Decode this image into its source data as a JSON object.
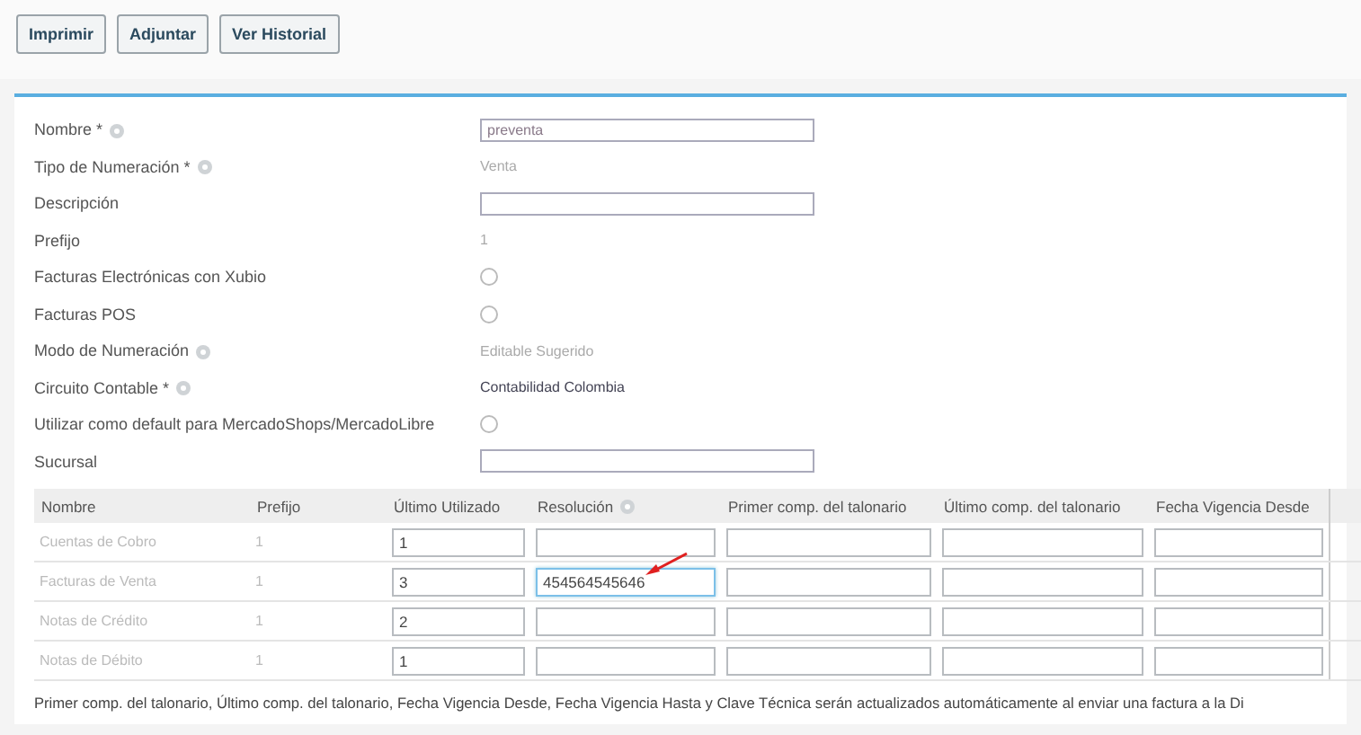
{
  "toolbar": {
    "buttons": [
      "Imprimir",
      "Adjuntar",
      "Ver Historial"
    ]
  },
  "form": {
    "fields": [
      {
        "label": "Nombre *",
        "help": true,
        "kind": "input",
        "value": "preventa"
      },
      {
        "label": "Tipo de Numeración *",
        "help": true,
        "kind": "text",
        "value": "Venta"
      },
      {
        "label": "Descripción",
        "help": false,
        "kind": "input"
      },
      {
        "label": "Prefijo",
        "help": false,
        "kind": "text",
        "value": "1"
      },
      {
        "label": "Facturas Electrónicas con Xubio",
        "help": false,
        "kind": "checkbox",
        "checked": false
      },
      {
        "label": "Facturas POS",
        "help": false,
        "kind": "checkbox",
        "checked": false
      },
      {
        "label": "Modo de Numeración",
        "help": true,
        "kind": "text",
        "value": "Editable Sugerido"
      },
      {
        "label": "Circuito Contable *",
        "help": true,
        "kind": "strong",
        "value": "Contabilidad Colombia"
      },
      {
        "label": "Utilizar como default para MercadoShops/MercadoLibre",
        "help": false,
        "kind": "checkbox",
        "checked": false
      },
      {
        "label": "Sucursal",
        "help": false,
        "kind": "input"
      }
    ]
  },
  "table": {
    "columns": [
      {
        "label": "Nombre",
        "help": false
      },
      {
        "label": "Prefijo",
        "help": false
      },
      {
        "label": "Último Utilizado",
        "help": false
      },
      {
        "label": "Resolución",
        "help": true
      },
      {
        "label": "Primer comp. del talonario",
        "help": false
      },
      {
        "label": "Último comp. del talonario",
        "help": false
      },
      {
        "label": "Fecha Vigencia Desde",
        "help": false
      }
    ],
    "rows": [
      {
        "name": "Cuentas de Cobro",
        "prefix": "1",
        "last_used": "1",
        "focused": false
      },
      {
        "name": "Facturas de Venta",
        "prefix": "1",
        "last_used": "3",
        "resolution": "454564545646",
        "focused": true
      },
      {
        "name": "Notas de Crédito",
        "prefix": "1",
        "last_used": "2",
        "focused": false
      },
      {
        "name": "Notas de Débito",
        "prefix": "1",
        "last_used": "1",
        "focused": false
      }
    ]
  },
  "note": "Primer comp. del talonario, Último comp. del talonario, Fecha Vigencia Desde, Fecha Vigencia Hasta y Clave Técnica serán actualizados automáticamente al enviar una factura a la Di"
}
